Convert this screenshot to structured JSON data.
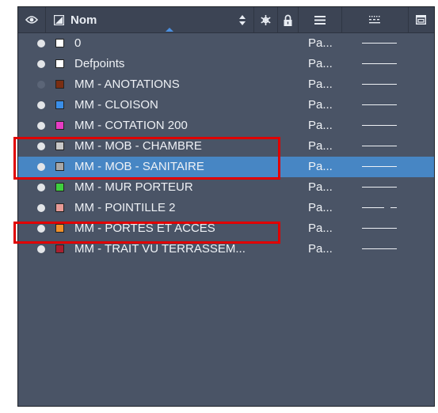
{
  "header": {
    "name_label": "Nom",
    "icons": [
      "eye-icon",
      "color-box-icon",
      "sort-arrows-icon",
      "snowflake-icon",
      "lock-icon",
      "menu-lines-icon",
      "dotted-lines-icon",
      "window-icon"
    ]
  },
  "colors": {
    "panel_bg": "#4a5466",
    "header_bg": "#3c4454",
    "selected_bg": "#4786c4",
    "highlight_border": "#e00000"
  },
  "layers": [
    {
      "name": "0",
      "color": "#ffffff",
      "visible": true,
      "linetype": "Pa...",
      "line_style": "solid",
      "selected": false
    },
    {
      "name": "Defpoints",
      "color": "#ffffff",
      "visible": true,
      "linetype": "Pa...",
      "line_style": "solid",
      "selected": false
    },
    {
      "name": "MM - ANOTATIONS",
      "color": "#7a2e12",
      "visible": false,
      "linetype": "Pa...",
      "line_style": "solid",
      "selected": false
    },
    {
      "name": "MM - CLOISON",
      "color": "#3a8ee8",
      "visible": true,
      "linetype": "Pa...",
      "line_style": "solid",
      "selected": false
    },
    {
      "name": "MM - COTATION 200",
      "color": "#e83cc4",
      "visible": true,
      "linetype": "Pa...",
      "line_style": "solid",
      "selected": false
    },
    {
      "name": "MM - MOB - CHAMBRE",
      "color": "#c8c8c8",
      "visible": true,
      "linetype": "Pa...",
      "line_style": "solid",
      "selected": false
    },
    {
      "name": "MM - MOB - SANITAIRE",
      "color": "#a8a8a8",
      "visible": true,
      "linetype": "Pa...",
      "line_style": "solid",
      "selected": true
    },
    {
      "name": "MM - MUR PORTEUR",
      "color": "#3ecf3e",
      "visible": true,
      "linetype": "Pa...",
      "line_style": "solid",
      "selected": false
    },
    {
      "name": "MM - POINTILLE 2",
      "color": "#e89a96",
      "visible": true,
      "linetype": "Pa...",
      "line_style": "dashed",
      "selected": false
    },
    {
      "name": "MM - PORTES ET ACCES",
      "color": "#f0902a",
      "visible": true,
      "linetype": "Pa...",
      "line_style": "solid",
      "selected": false
    },
    {
      "name": "MM - TRAIT VU TERRASSEM...",
      "color": "#a82030",
      "visible": true,
      "linetype": "Pa...",
      "line_style": "solid",
      "selected": false
    }
  ]
}
